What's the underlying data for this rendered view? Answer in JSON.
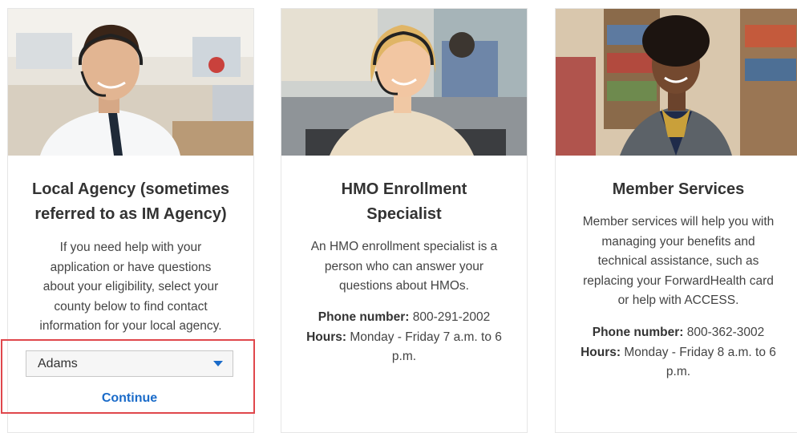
{
  "cards": [
    {
      "title_line1": "Local Agency (sometimes",
      "title_line2": "referred to as IM Agency)",
      "description_lines": [
        "If you need help with your",
        "application or have questions",
        "about your eligibility, select your",
        "county below to find contact",
        "information for your local agency."
      ],
      "county_select": {
        "selected": "Adams"
      },
      "continue_label": "Continue"
    },
    {
      "title_line1": "HMO Enrollment",
      "title_line2": "Specialist",
      "description_lines": [
        "An HMO enrollment specialist is a",
        "person who can answer your",
        "questions about HMOs."
      ],
      "phone_label": "Phone number:",
      "phone_value": "800-291-2002",
      "hours_label": "Hours:",
      "hours_value_line1": "Monday - Friday 7 a.m. to 6",
      "hours_value_line2": "p.m."
    },
    {
      "title_line1": "Member Services",
      "description_lines": [
        "Member services will help you with",
        "managing your benefits and",
        "technical assistance, such as",
        "replacing your ForwardHealth card",
        "or help with ACCESS."
      ],
      "phone_label": "Phone number:",
      "phone_value": "800-362-3002",
      "hours_label": "Hours:",
      "hours_value_line1": "Monday - Friday 8 a.m. to 6",
      "hours_value_line2": "p.m."
    }
  ],
  "colors": {
    "link": "#1a6bc9",
    "highlight_border": "#e0474c",
    "card_border": "#e6e6e6"
  },
  "icons": {
    "select_caret": "caret-down-icon"
  }
}
